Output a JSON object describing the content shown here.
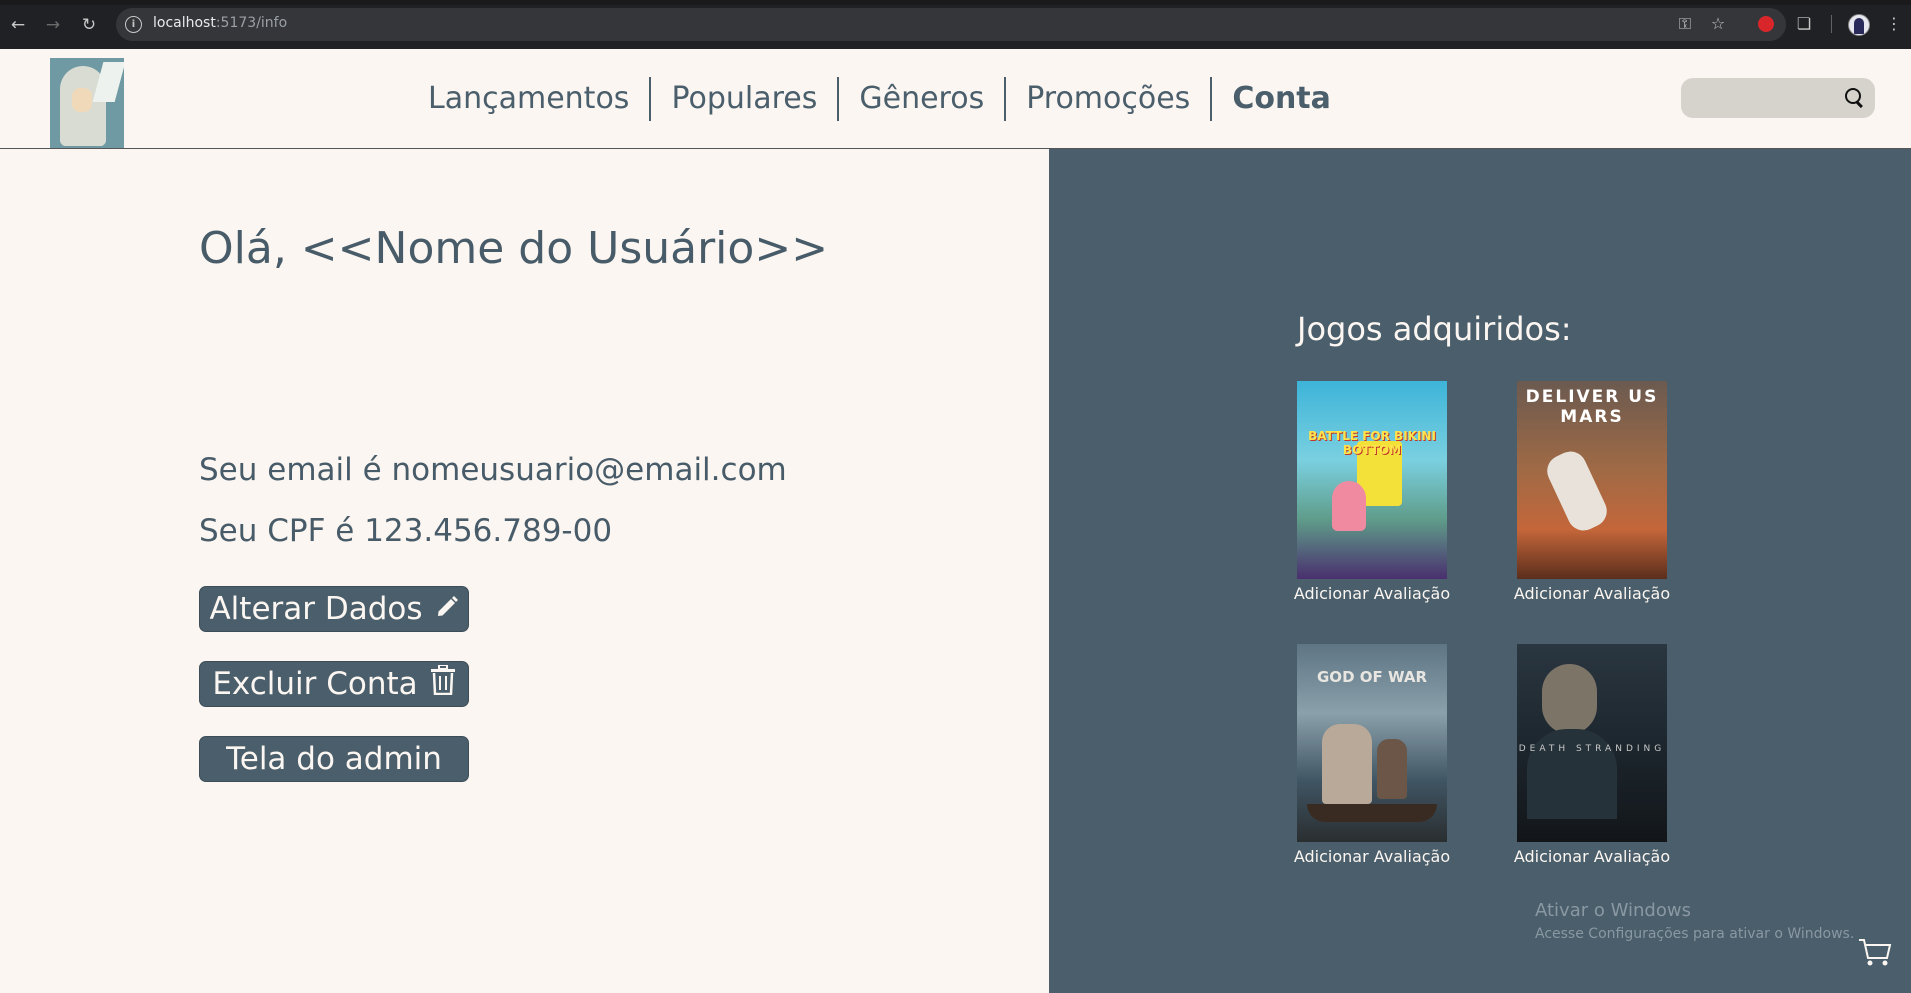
{
  "browser": {
    "url_host": "localhost",
    "url_path": ":5173/info",
    "icons": [
      "back-icon",
      "forward-icon",
      "reload-icon",
      "site-info-icon",
      "password-key-icon",
      "bookmark-star-icon",
      "extension-icon",
      "puzzle-icon",
      "profile-avatar",
      "menu-icon"
    ]
  },
  "header": {
    "nav": [
      {
        "label": "Lançamentos"
      },
      {
        "label": "Populares"
      },
      {
        "label": "Gêneros"
      },
      {
        "label": "Promoções"
      },
      {
        "label": "Conta",
        "active": true
      }
    ],
    "search": {
      "placeholder": "",
      "icon": "search-icon"
    }
  },
  "account": {
    "greeting": "Olá, <<Nome do Usuário>>",
    "email_line": "Seu email é nomeusuario@email.com",
    "cpf_line": "Seu CPF é 123.456.789-00",
    "buttons": {
      "edit": {
        "label": "Alterar Dados",
        "icon": "pencil-icon"
      },
      "delete": {
        "label": "Excluir Conta",
        "icon": "trash-icon"
      },
      "admin": {
        "label": "Tela do admin"
      }
    }
  },
  "games": {
    "title": "Jogos adquiridos:",
    "items": [
      {
        "cover_text": "BATTLE FOR BIKINI BOTTOM",
        "action": "Adicionar Avaliação"
      },
      {
        "cover_text": "DELIVER US MARS",
        "action": "Adicionar Avaliação"
      },
      {
        "cover_text": "GOD OF WAR",
        "action": "Adicionar Avaliação"
      },
      {
        "cover_text": "DEATH STRANDING",
        "action": "Adicionar Avaliação"
      }
    ]
  },
  "watermark": {
    "line1": "Ativar o Windows",
    "line2": "Acesse Configurações para ativar o Windows."
  },
  "colors": {
    "primary": "#4a5e6b",
    "background": "#fbf6f1"
  }
}
